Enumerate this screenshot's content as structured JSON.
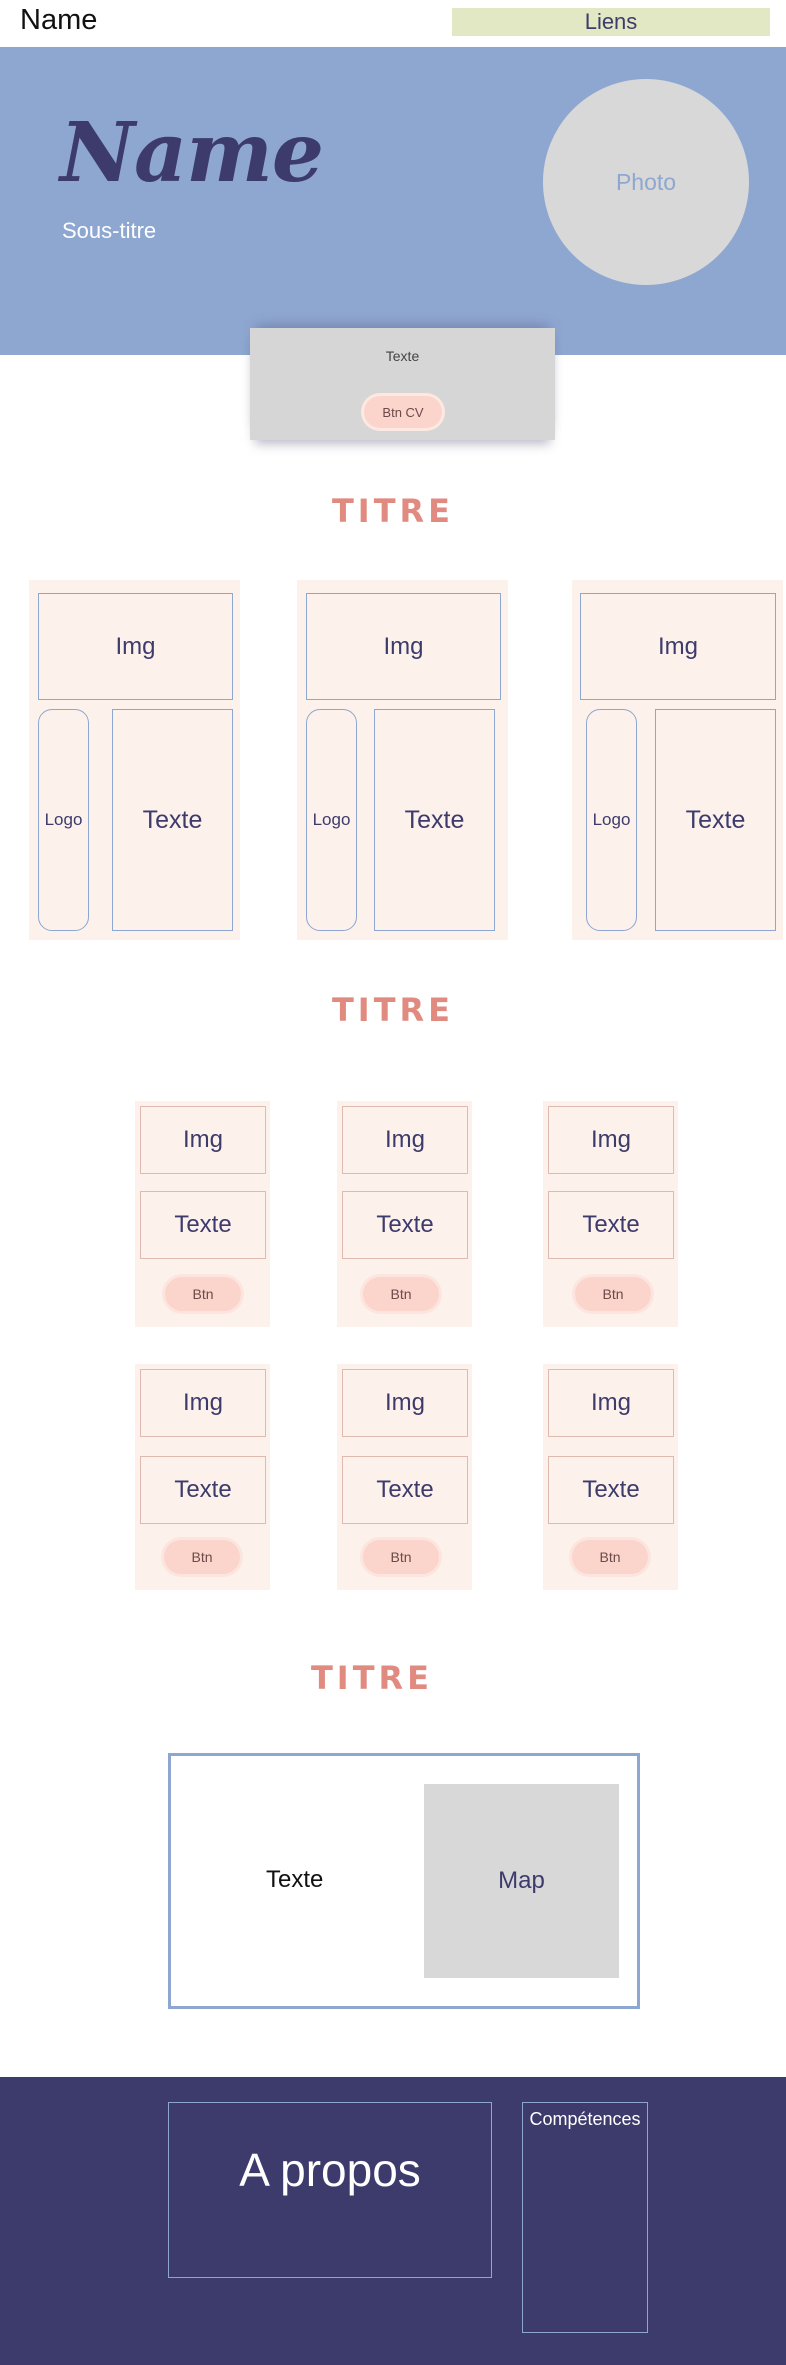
{
  "header": {
    "brand": "Name",
    "links": "Liens"
  },
  "hero": {
    "name": "Name",
    "subtitle": "Sous-titre",
    "photo": "Photo"
  },
  "intro": {
    "text": "Texte",
    "cv_button": "Btn CV"
  },
  "projects": {
    "title": "TITRE",
    "cards": [
      {
        "img": "Img",
        "logo": "Logo",
        "text": "Texte"
      },
      {
        "img": "Img",
        "logo": "Logo",
        "text": "Texte"
      },
      {
        "img": "Img",
        "logo": "Logo",
        "text": "Texte"
      }
    ]
  },
  "services": {
    "title": "TITRE",
    "cards": [
      {
        "img": "Img",
        "text": "Texte",
        "button": "Btn"
      },
      {
        "img": "Img",
        "text": "Texte",
        "button": "Btn"
      },
      {
        "img": "Img",
        "text": "Texte",
        "button": "Btn"
      },
      {
        "img": "Img",
        "text": "Texte",
        "button": "Btn"
      },
      {
        "img": "Img",
        "text": "Texte",
        "button": "Btn"
      },
      {
        "img": "Img",
        "text": "Texte",
        "button": "Btn"
      }
    ]
  },
  "contact": {
    "title": "TITRE",
    "text": "Texte",
    "map": "Map"
  },
  "footer": {
    "about": "A propos",
    "skills": "Compétences"
  },
  "colors": {
    "hero_blue": "#8ea7d1",
    "navy": "#3d3b6c",
    "accent_salmon": "#e08a80",
    "card_bg": "#fdf1ec",
    "button_pink": "#fbd5cb",
    "links_bg": "#e2e7c4",
    "placeholder_gray": "#d8d8d8"
  }
}
